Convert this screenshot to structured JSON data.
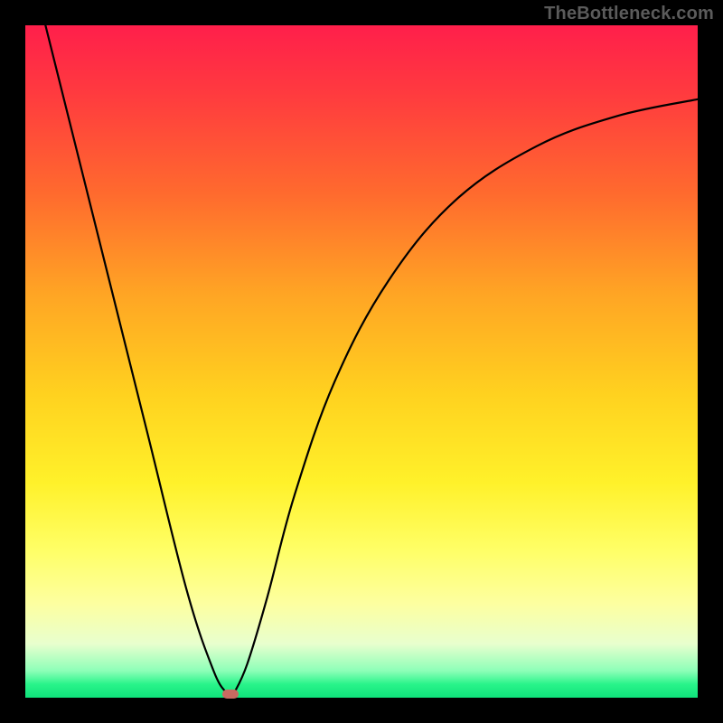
{
  "watermark": "TheBottleneck.com",
  "chart_data": {
    "type": "line",
    "title": "",
    "xlabel": "",
    "ylabel": "",
    "xlim": [
      0,
      100
    ],
    "ylim": [
      0,
      100
    ],
    "grid": false,
    "legend": false,
    "series": [
      {
        "name": "curve",
        "x": [
          3,
          10,
          18,
          24,
          28,
          30,
          30.5,
          31,
          33,
          36,
          40,
          46,
          54,
          64,
          76,
          88,
          100
        ],
        "y": [
          100,
          72,
          40,
          16,
          4,
          0.6,
          0,
          0.6,
          5,
          15,
          30,
          47,
          62,
          74,
          82,
          86.5,
          89
        ]
      }
    ],
    "marker": {
      "x": 30.5,
      "y": 0.6,
      "color": "#c96a61"
    },
    "background_gradient": [
      "#ff1f4b",
      "#ffa524",
      "#fff12a",
      "#0fe27b"
    ]
  }
}
